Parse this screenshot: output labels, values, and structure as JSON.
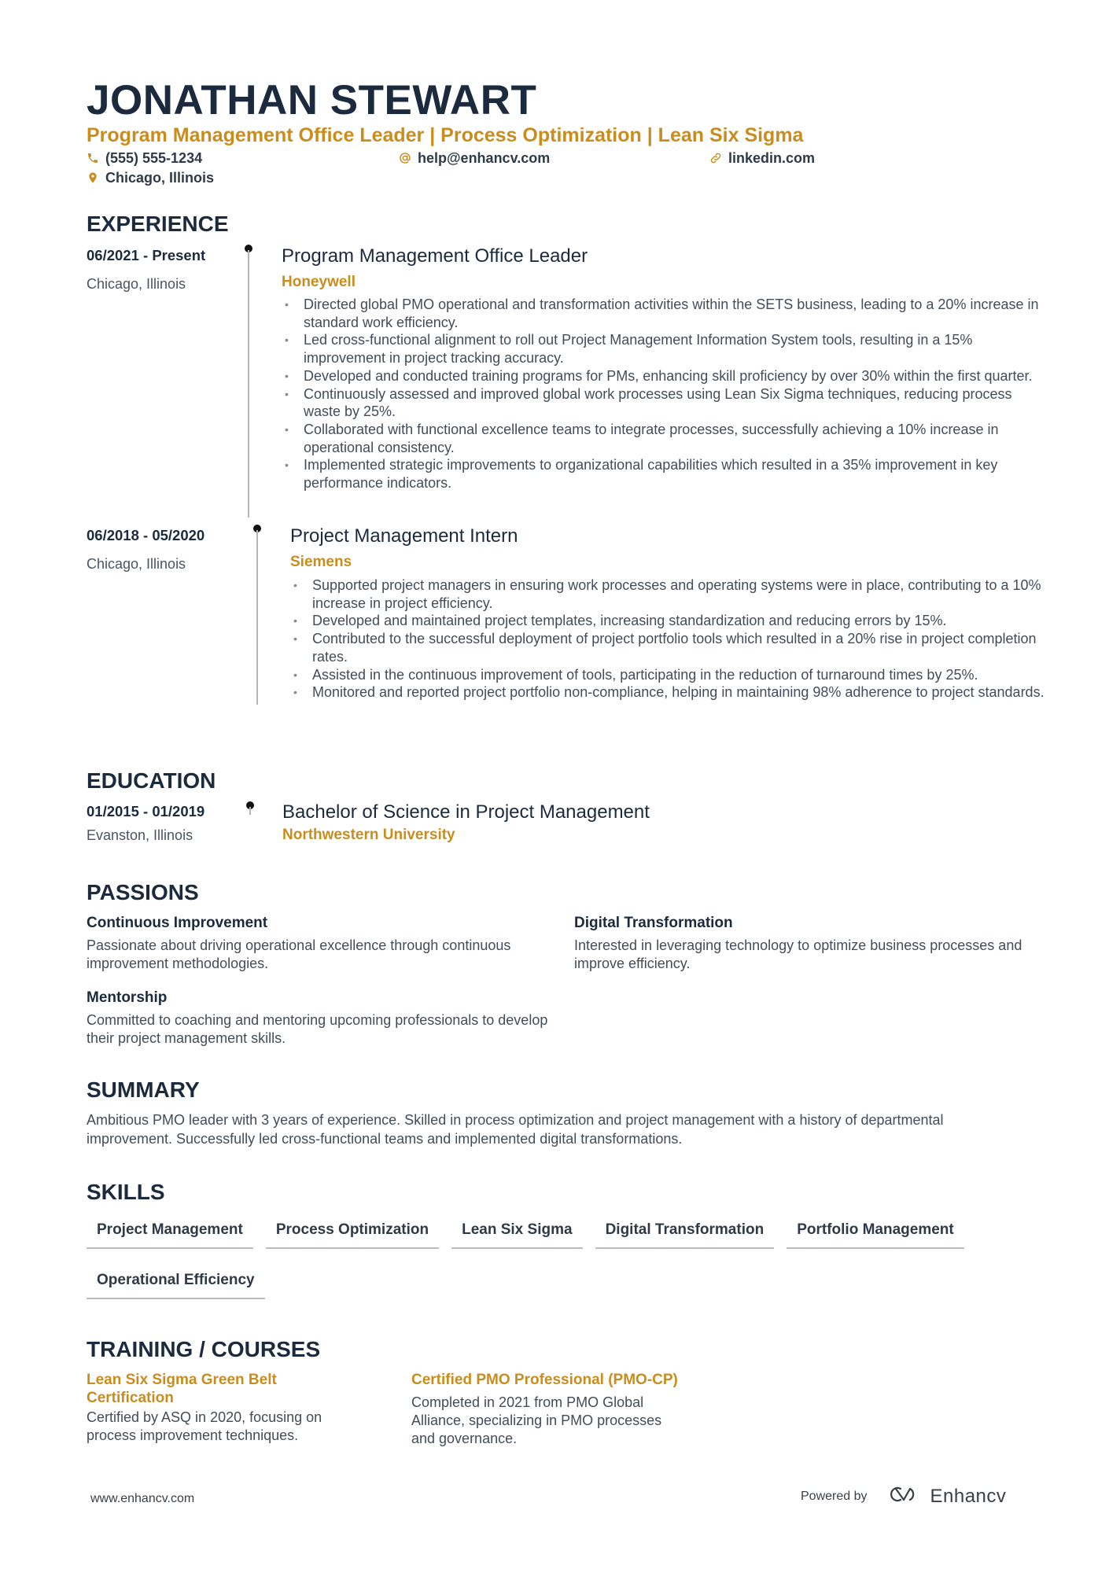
{
  "header": {
    "name": "JONATHAN STEWART",
    "headline": "Program Management Office Leader | Process Optimization | Lean Six Sigma",
    "contacts": {
      "phone": {
        "icon": "phone-icon",
        "value": "(555) 555-1234"
      },
      "email": {
        "icon": "at-icon",
        "value": "help@enhancv.com"
      },
      "linkedin": {
        "icon": "link-icon",
        "value": "linkedin.com"
      },
      "location": {
        "icon": "location-pin-icon",
        "value": "Chicago, Illinois"
      }
    }
  },
  "colors": {
    "accent": "#c98d1e",
    "heading": "#1c2a3e",
    "body": "#434c58"
  },
  "experience": {
    "title": "EXPERIENCE",
    "items": [
      {
        "date": "06/2021 - Present",
        "location": "Chicago, Illinois",
        "role": "Program Management Office Leader",
        "company": "Honeywell",
        "bullets": [
          "Directed global PMO operational and transformation activities within the SETS business, leading to a 20% increase in standard work efficiency.",
          "Led cross-functional alignment to roll out Project Management Information System tools, resulting in a 15% improvement in project tracking accuracy.",
          "Developed and conducted training programs for PMs, enhancing skill proficiency by over 30% within the first quarter.",
          "Continuously assessed and improved global work processes using Lean Six Sigma techniques, reducing process waste by 25%.",
          "Collaborated with functional excellence teams to integrate processes, successfully achieving a 10% increase in operational consistency.",
          "Implemented strategic improvements to organizational capabilities which resulted in a 35% improvement in key performance indicators."
        ]
      },
      {
        "date": "06/2018 - 05/2020",
        "location": "Chicago, Illinois",
        "role": "Project Management Intern",
        "company": "Siemens",
        "bullets": [
          "Supported project managers in ensuring work processes and operating systems were in place, contributing to a 10% increase in project efficiency.",
          "Developed and maintained project templates, increasing standardization and reducing errors by 15%.",
          "Contributed to the successful deployment of project portfolio tools which resulted in a 20% rise in project completion rates.",
          "Assisted in the continuous improvement of tools, participating in the reduction of turnaround times by 25%.",
          "Monitored and reported project portfolio non-compliance, helping in maintaining 98% adherence to project standards."
        ]
      }
    ]
  },
  "education": {
    "title": "EDUCATION",
    "items": [
      {
        "date": "01/2015 - 01/2019",
        "location": "Evanston, Illinois",
        "degree": "Bachelor of Science in Project Management",
        "school": "Northwestern University"
      }
    ]
  },
  "passions": {
    "title": "PASSIONS",
    "items": [
      {
        "title": "Continuous Improvement",
        "desc": "Passionate about driving operational excellence through continuous improvement methodologies."
      },
      {
        "title": "Digital Transformation",
        "desc": "Interested in leveraging technology to optimize business processes and improve efficiency."
      },
      {
        "title": "Mentorship",
        "desc": "Committed to coaching and mentoring upcoming professionals to develop their project management skills."
      }
    ]
  },
  "summary": {
    "title": "SUMMARY",
    "text": "Ambitious PMO leader with 3 years of experience. Skilled in process optimization and project management with a history of departmental improvement. Successfully led cross-functional teams and implemented digital transformations."
  },
  "skills": {
    "title": "SKILLS",
    "items": [
      "Project Management",
      "Process Optimization",
      "Lean Six Sigma",
      "Digital Transformation",
      "Portfolio Management",
      "Operational Efficiency"
    ]
  },
  "training": {
    "title": "TRAINING / COURSES",
    "items": [
      {
        "title": "Lean Six Sigma Green Belt Certification",
        "desc": "Certified by ASQ in 2020, focusing on process improvement techniques."
      },
      {
        "title": "Certified PMO Professional (PMO-CP)",
        "desc": "Completed in 2021 from PMO Global Alliance, specializing in PMO processes and governance."
      }
    ]
  },
  "footer": {
    "website": "www.enhancv.com",
    "powered_by": "Powered by",
    "brand": "Enhancv",
    "brand_icon": "enhancv-logo-icon"
  }
}
